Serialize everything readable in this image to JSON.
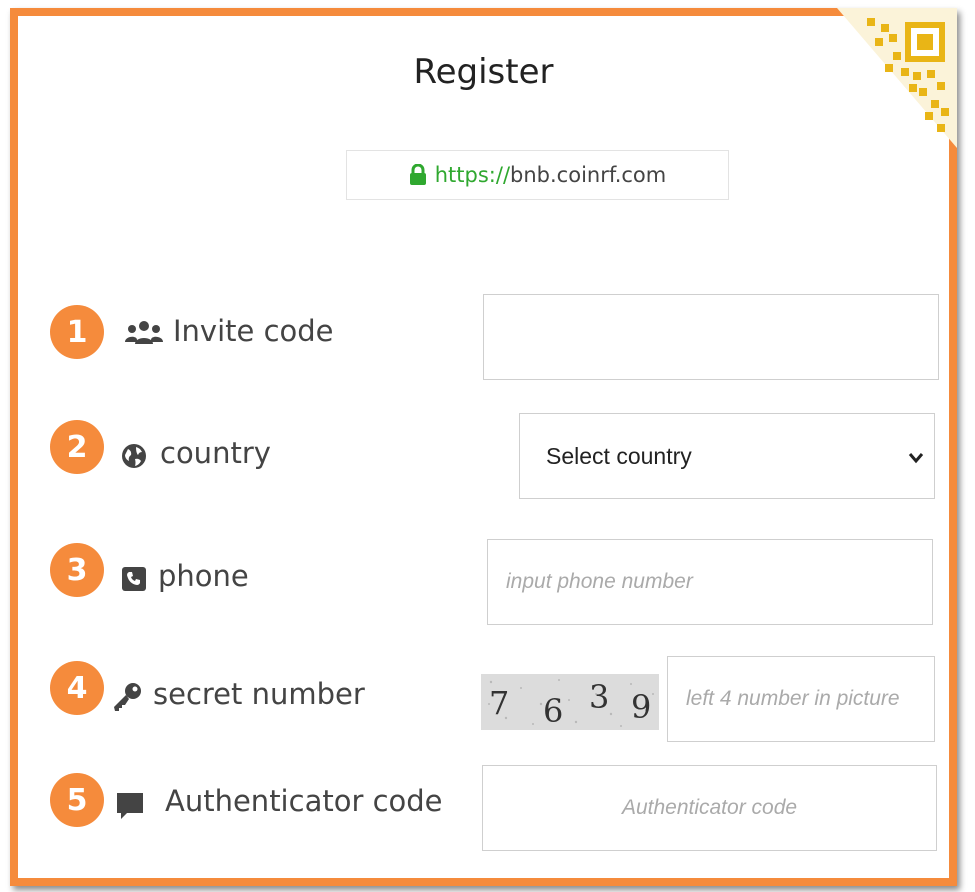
{
  "page": {
    "title": "Register",
    "url": {
      "scheme": "https://",
      "host": "bnb.coinrf.com"
    }
  },
  "fields": {
    "invite": {
      "number": "1",
      "label": "Invite code",
      "icon": "users-icon",
      "value": "",
      "placeholder": ""
    },
    "country": {
      "number": "2",
      "label": "country",
      "icon": "globe-icon",
      "selected": "Select country"
    },
    "phone": {
      "number": "3",
      "label": "phone",
      "icon": "phone-icon",
      "placeholder": "input phone number"
    },
    "secret": {
      "number": "4",
      "label": "secret number",
      "icon": "key-icon",
      "placeholder": "left 4 number in picture",
      "captcha_digits": [
        "7",
        "6",
        "3",
        "9"
      ]
    },
    "auth": {
      "number": "5",
      "label": "Authenticator code",
      "icon": "chat-icon",
      "placeholder": "Authenticator code"
    }
  },
  "colors": {
    "accent": "#f58b3c",
    "secure": "#2fa82f",
    "qr": "#e9b516"
  }
}
